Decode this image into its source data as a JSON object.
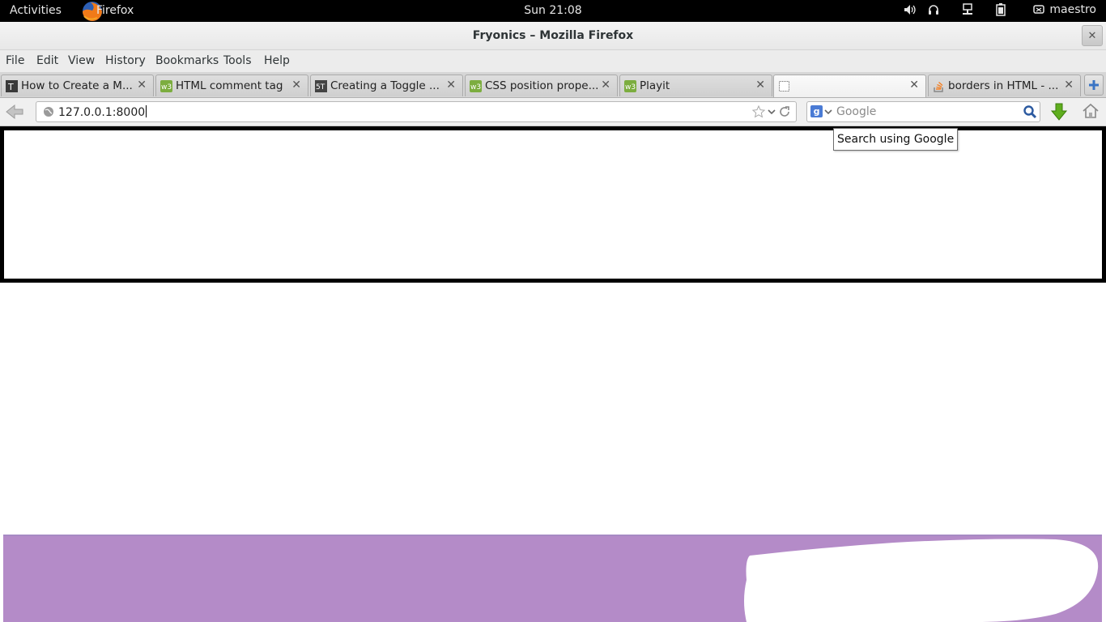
{
  "topbar": {
    "activities": "Activities",
    "app_name": "Firefox",
    "clock": "Sun 21:08",
    "user": "maestro",
    "tray_icons": [
      "volume-icon",
      "headphones-icon",
      "network-icon",
      "battery-icon",
      "user-icon"
    ]
  },
  "window": {
    "title": "Fryonics – Mozilla Firefox",
    "close_glyph": "✕"
  },
  "menu": {
    "items": [
      "File",
      "Edit",
      "View",
      "History",
      "Bookmarks",
      "Tools",
      "Help"
    ]
  },
  "tabs": [
    {
      "label": "How to Create a M...",
      "favicon": "wikihow-icon",
      "active": false
    },
    {
      "label": "HTML comment tag",
      "favicon": "w3schools-icon",
      "active": false
    },
    {
      "label": "Creating a Toggle ...",
      "favicon": "site-51-icon",
      "active": false
    },
    {
      "label": "CSS position prope...",
      "favicon": "w3schools-icon",
      "active": false
    },
    {
      "label": "Playit",
      "favicon": "w3schools-icon",
      "active": false
    },
    {
      "label": "",
      "favicon": "blank-page-icon",
      "active": true
    },
    {
      "label": "borders in HTML - ...",
      "favicon": "stackoverflow-icon",
      "active": false
    }
  ],
  "tab_close_glyph": "✕",
  "navbar": {
    "url": "127.0.0.1:8000",
    "search_engine": "Google",
    "search_placeholder": "Google"
  },
  "tooltip": {
    "text": "Search using Google"
  },
  "colors": {
    "footer_purple": "#b48bc8",
    "border_black": "#000000",
    "download_green": "#5fae1e"
  }
}
